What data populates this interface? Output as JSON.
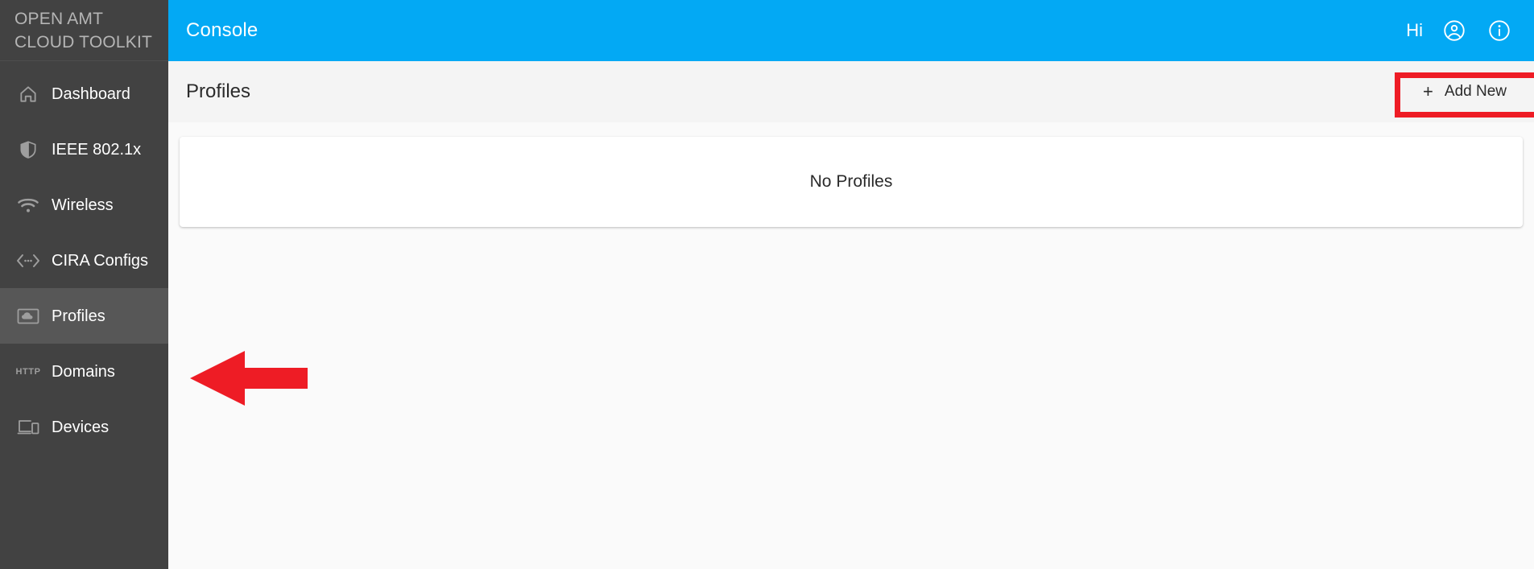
{
  "brand": {
    "line1": "OPEN AMT",
    "line2": "CLOUD TOOLKIT",
    "full": "OPEN AMT\nCLOUD TOOLKIT"
  },
  "topbar": {
    "title": "Console",
    "greeting": "Hi",
    "account_icon": "account-circle-icon",
    "info_icon": "info-circle-icon",
    "background_color": "#03a9f4"
  },
  "sidebar": {
    "background_color": "#424242",
    "active_background_color": "#575757",
    "items": [
      {
        "label": "Dashboard",
        "icon": "home-icon",
        "active": false
      },
      {
        "label": "IEEE 802.1x",
        "icon": "shield-icon",
        "active": false
      },
      {
        "label": "Wireless",
        "icon": "wifi-icon",
        "active": false
      },
      {
        "label": "CIRA Configs",
        "icon": "code-icon",
        "active": false
      },
      {
        "label": "Profiles",
        "icon": "cloud-box-icon",
        "active": true
      },
      {
        "label": "Domains",
        "icon": "http-icon",
        "active": false
      },
      {
        "label": "Devices",
        "icon": "devices-icon",
        "active": false
      }
    ]
  },
  "toolbar": {
    "page_title": "Profiles",
    "add_new_label": "Add New",
    "add_new_plus": "+"
  },
  "main": {
    "empty_state_text": "No Profiles"
  },
  "annotations": {
    "highlight_color": "#ee1c25",
    "box_target": "add-new-button",
    "arrow_target": "sidebar-item-profiles",
    "arrow_direction": "left"
  }
}
